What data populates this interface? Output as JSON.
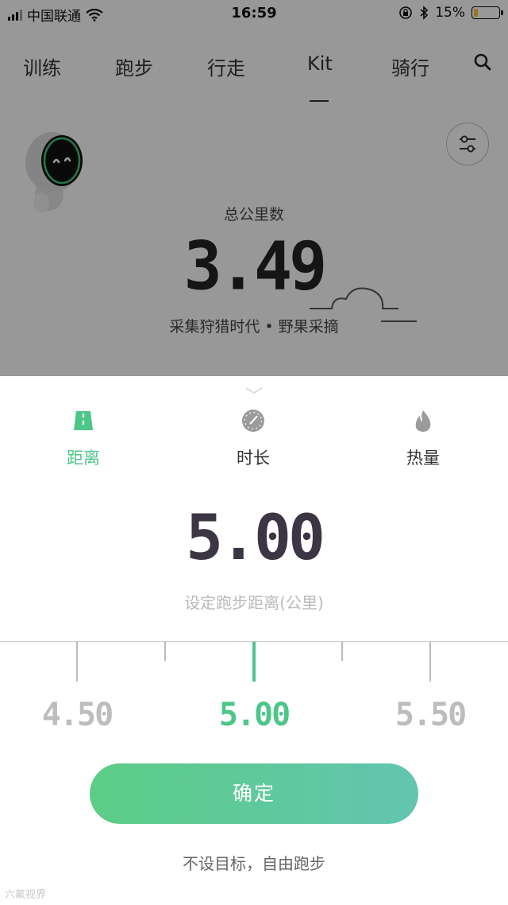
{
  "status_bar": {
    "carrier": "中国联通",
    "time": "16:59",
    "battery": "15%",
    "icons": [
      "signal-icon",
      "wifi-icon",
      "rotation-lock-icon",
      "bluetooth-icon",
      "battery-icon"
    ]
  },
  "tabs": [
    {
      "label": "训练"
    },
    {
      "label": "跑步"
    },
    {
      "label": "行走"
    },
    {
      "label": "Kit",
      "active": true
    },
    {
      "label": "骑行"
    }
  ],
  "summary": {
    "total_label": "总公里数",
    "total_value": "3.49",
    "subtitle": "采集狩猎时代 • 野果采摘"
  },
  "goal_modes": [
    {
      "label": "距离",
      "icon": "road-icon",
      "active": true
    },
    {
      "label": "时长",
      "icon": "clock-icon",
      "active": false
    },
    {
      "label": "热量",
      "icon": "flame-icon",
      "active": false
    }
  ],
  "target": {
    "value": "5.00",
    "label": "设定跑步距离(公里)"
  },
  "ruler": {
    "labels": [
      "4.50",
      "5.00",
      "5.50"
    ],
    "selected": "5.00"
  },
  "actions": {
    "confirm": "确定",
    "free_run": "不设目标，自由跑步"
  },
  "watermark": "六氟视界",
  "colors": {
    "accent": "#4cc689",
    "button_gradient_start": "#5dcd86",
    "button_gradient_end": "#62c5b0",
    "overlay": "rgba(0,0,0,0.38)"
  }
}
